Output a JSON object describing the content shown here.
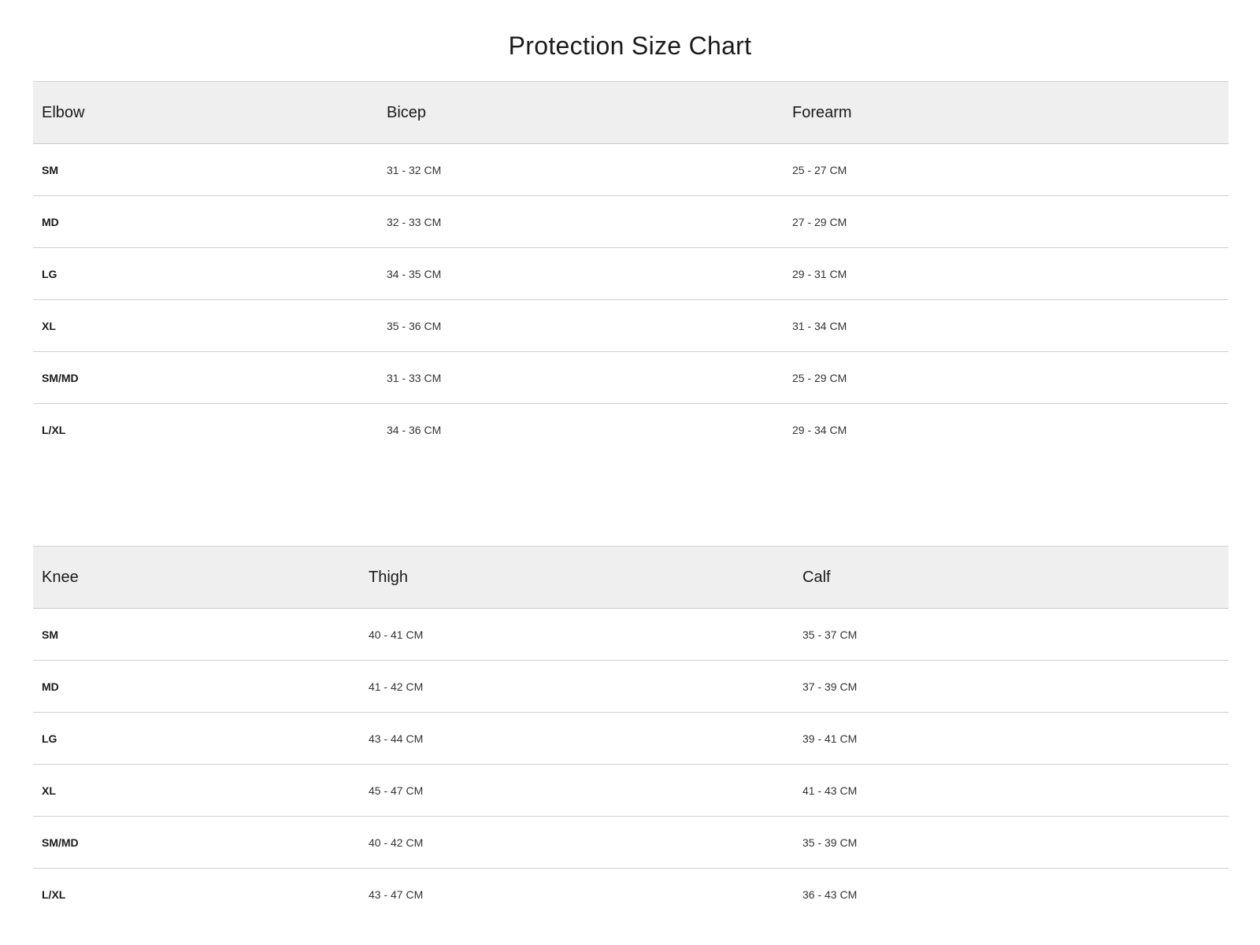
{
  "title": "Protection Size Chart",
  "elbow_table": {
    "headers": [
      "Elbow",
      "Bicep",
      "Forearm"
    ],
    "rows": [
      [
        "SM",
        "31 - 32 CM",
        "25 - 27 CM"
      ],
      [
        "MD",
        "32 - 33 CM",
        "27 - 29 CM"
      ],
      [
        "LG",
        "34 - 35 CM",
        "29 - 31 CM"
      ],
      [
        "XL",
        "35 - 36 CM",
        "31 - 34 CM"
      ],
      [
        "SM/MD",
        "31 - 33 CM",
        "25 - 29 CM"
      ],
      [
        "L/XL",
        "34 - 36 CM",
        "29 - 34 CM"
      ]
    ]
  },
  "knee_table": {
    "headers": [
      "Knee",
      "Thigh",
      "Calf"
    ],
    "rows": [
      [
        "SM",
        "40 - 41 CM",
        "35 - 37 CM"
      ],
      [
        "MD",
        "41 - 42 CM",
        "37 - 39 CM"
      ],
      [
        "LG",
        "43 - 44 CM",
        "39 - 41 CM"
      ],
      [
        "XL",
        "45 - 47 CM",
        "41 - 43 CM"
      ],
      [
        "SM/MD",
        "40 - 42 CM",
        "35 - 39 CM"
      ],
      [
        "L/XL",
        "43 - 47 CM",
        "36 - 43 CM"
      ]
    ]
  }
}
